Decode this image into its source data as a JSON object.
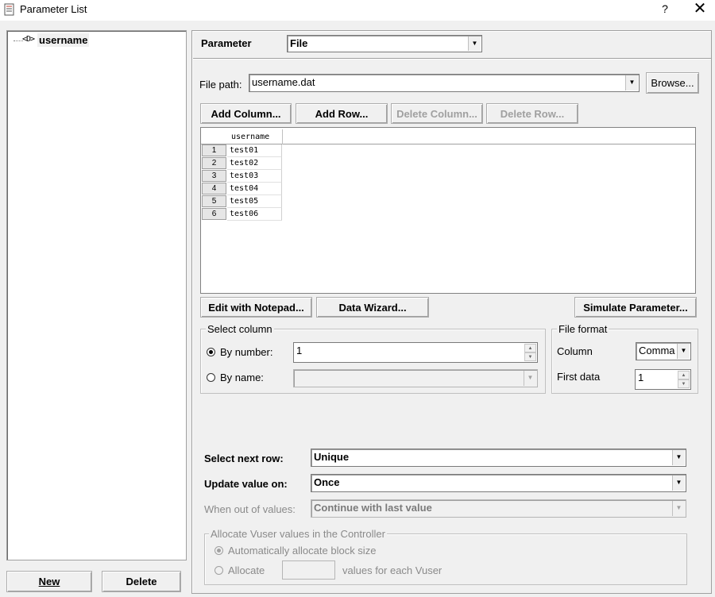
{
  "window": {
    "title": "Parameter List",
    "help": "?",
    "close": "✕"
  },
  "tree": {
    "items": [
      {
        "icon": "<D>",
        "label": "username"
      }
    ]
  },
  "left_buttons": {
    "new": "New",
    "delete": "Delete"
  },
  "parameter": {
    "label": "Parameter",
    "type_value": "File"
  },
  "file_path": {
    "label": "File path:",
    "value": "username.dat",
    "browse": "Browse..."
  },
  "table_buttons": {
    "add_column": "Add Column...",
    "add_row": "Add Row...",
    "delete_column": "Delete Column...",
    "delete_row": "Delete Row..."
  },
  "table": {
    "columns": [
      "username"
    ],
    "rows": [
      {
        "num": "1",
        "value": "test01"
      },
      {
        "num": "2",
        "value": "test02"
      },
      {
        "num": "3",
        "value": "test03"
      },
      {
        "num": "4",
        "value": "test04"
      },
      {
        "num": "5",
        "value": "test05"
      },
      {
        "num": "6",
        "value": "test06"
      }
    ]
  },
  "action_buttons": {
    "edit_notepad": "Edit with Notepad...",
    "data_wizard": "Data Wizard...",
    "simulate": "Simulate Parameter..."
  },
  "select_column": {
    "title": "Select column",
    "by_number_label": "By number:",
    "by_number_value": "1",
    "by_name_label": "By name:",
    "selected": "by_number"
  },
  "file_format": {
    "title": "File format",
    "column_label": "Column",
    "column_value": "Comma",
    "first_data_label": "First data",
    "first_data_value": "1"
  },
  "row_options": {
    "select_next_row_label": "Select next row:",
    "select_next_row_value": "Unique",
    "update_value_label": "Update value on:",
    "update_value_value": "Once",
    "out_of_values_label": "When out of values:",
    "out_of_values_value": "Continue with last value"
  },
  "allocate": {
    "title": "Allocate Vuser values in the Controller",
    "auto_label": "Automatically allocate block size",
    "allocate_label": "Allocate",
    "values_suffix": "values for each Vuser",
    "selected": "auto"
  }
}
